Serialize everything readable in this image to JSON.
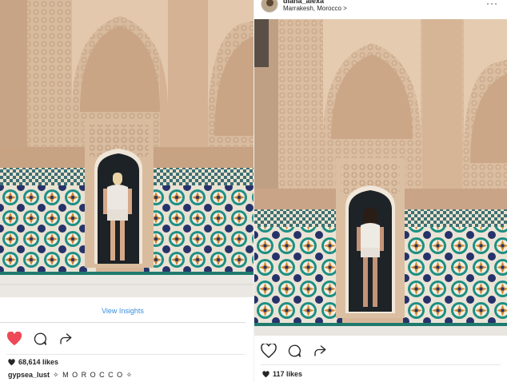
{
  "left_post": {
    "insights_label": "View Insights",
    "likes": "68,614 likes",
    "caption_user": "gypsea_lust",
    "caption_text": "✧ M O R O C C O ✧",
    "heart_color": "#ed4956"
  },
  "right_post": {
    "username": "diana_alexa",
    "location": "Marrakesh, Morocco",
    "location_chevron": ">",
    "more_label": "···",
    "likes": "117 likes"
  },
  "icons": [
    "heart-icon",
    "comment-icon",
    "share-icon",
    "more-icon",
    "avatar"
  ],
  "colors": {
    "link": "#3a8dde",
    "stone": "#d8b597",
    "tile_teal": "#1f8f86",
    "heart": "#ed4956"
  }
}
